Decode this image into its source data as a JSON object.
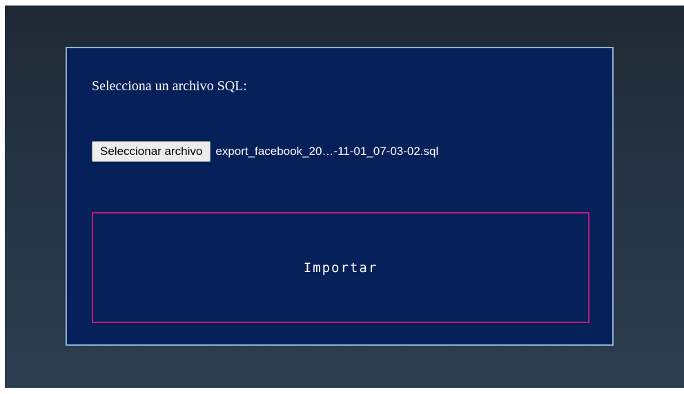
{
  "form": {
    "prompt": "Selecciona un archivo SQL:",
    "file_button_label": "Seleccionar archivo",
    "file_name": "export_facebook_20…-11-01_07-03-02.sql",
    "submit_label": "Importar"
  },
  "colors": {
    "page_background": "#ffffff",
    "stage_gradient_top": "#1f2934",
    "stage_gradient_bottom": "#2b3d4f",
    "panel_background": "#06205a",
    "panel_border": "#8fb2cc",
    "import_border": "#c2187d",
    "text": "#ffffff"
  }
}
